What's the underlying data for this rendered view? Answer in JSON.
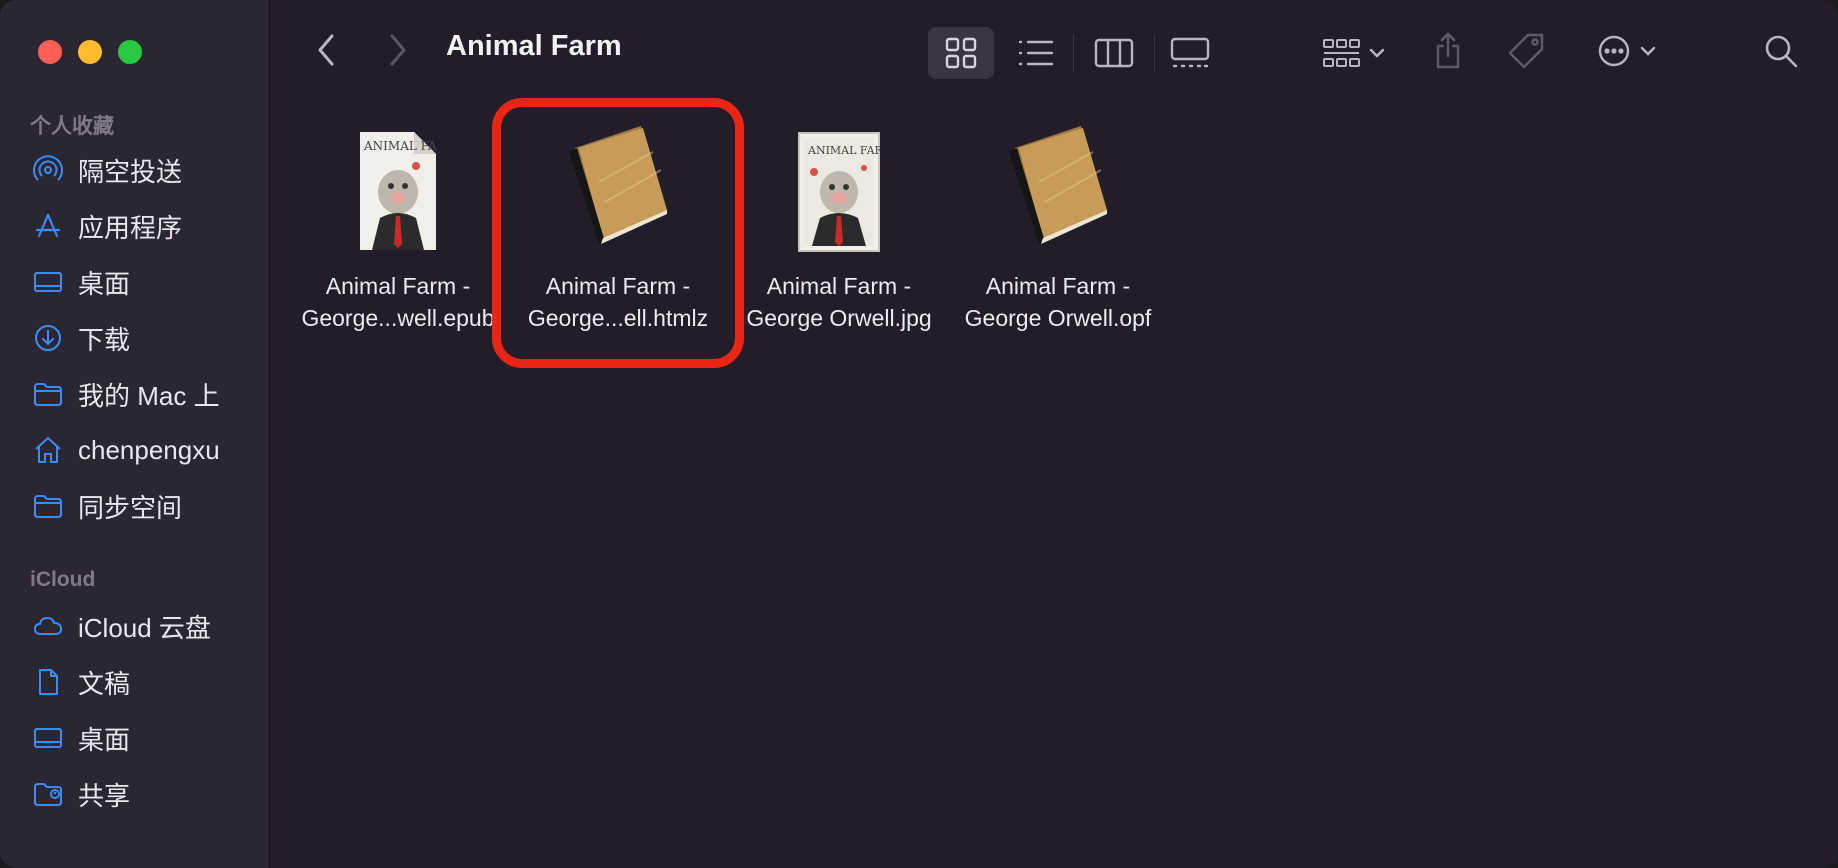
{
  "window": {
    "title": "Animal Farm"
  },
  "sidebar": {
    "favorites_title": "个人收藏",
    "favorites": [
      {
        "label": "隔空投送",
        "icon": "airdrop-icon"
      },
      {
        "label": "应用程序",
        "icon": "applications-icon"
      },
      {
        "label": "桌面",
        "icon": "desktop-icon"
      },
      {
        "label": "下载",
        "icon": "download-icon"
      },
      {
        "label": "我的 Mac 上",
        "icon": "folder-icon"
      },
      {
        "label": "chenpengxu",
        "icon": "home-icon"
      },
      {
        "label": "同步空间",
        "icon": "folder-icon"
      }
    ],
    "icloud_title": "iCloud",
    "icloud": [
      {
        "label": "iCloud 云盘",
        "icon": "cloud-icon"
      },
      {
        "label": "文稿",
        "icon": "document-icon"
      },
      {
        "label": "桌面",
        "icon": "desktop-icon"
      },
      {
        "label": "共享",
        "icon": "shared-folder-icon"
      }
    ]
  },
  "files": [
    {
      "line1": "Animal Farm -",
      "line2": "George...well.epub",
      "icon": "epub-cover-icon"
    },
    {
      "line1": "Animal Farm -",
      "line2": "George...ell.htmlz",
      "icon": "book-icon",
      "highlighted": true
    },
    {
      "line1": "Animal Farm -",
      "line2": "George Orwell.jpg",
      "icon": "image-cover-icon"
    },
    {
      "line1": "Animal Farm -",
      "line2": "George Orwell.opf",
      "icon": "book-icon"
    }
  ],
  "colors": {
    "accent_blue": "#3b8cf6",
    "highlight_red": "#ea2516"
  }
}
